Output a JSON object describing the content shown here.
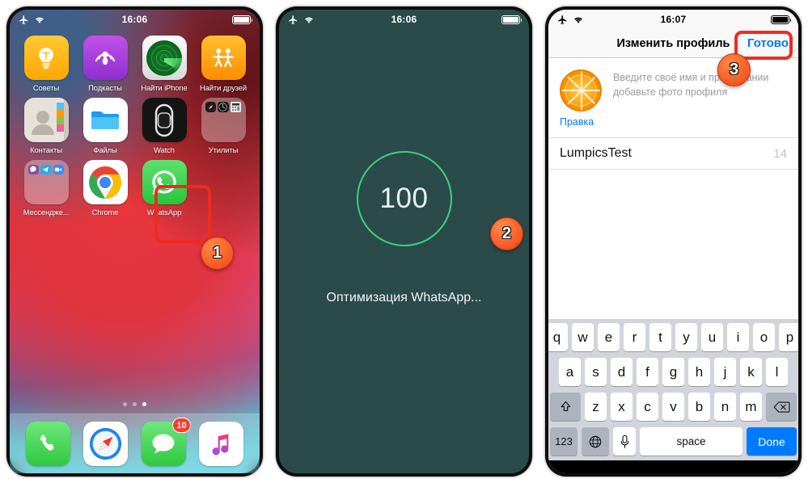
{
  "screens": [
    {
      "id": "home-screen",
      "status": {
        "airplane_icon": "airplane-mode-icon",
        "wifi_icon": "wifi-icon",
        "time": "16:06",
        "battery_icon": "battery-full-icon"
      },
      "apps_rows": [
        [
          {
            "label": "Советы",
            "icon": "tips-icon"
          },
          {
            "label": "Подкасты",
            "icon": "podcasts-icon"
          },
          {
            "label": "Найти iPhone",
            "icon": "find-my-iphone-icon"
          },
          {
            "label": "Найти друзей",
            "icon": "find-my-friends-icon"
          }
        ],
        [
          {
            "label": "Контакты",
            "icon": "contacts-icon"
          },
          {
            "label": "Файлы",
            "icon": "files-icon"
          },
          {
            "label": "Watch",
            "icon": "watch-icon"
          },
          {
            "label": "Утилиты",
            "icon": "utilities-folder-icon"
          }
        ],
        [
          {
            "label": "Мессендже...",
            "icon": "messengers-folder-icon"
          },
          {
            "label": "Chrome",
            "icon": "chrome-icon"
          },
          {
            "label": "WhatsApp",
            "icon": "whatsapp-icon"
          }
        ]
      ],
      "page_dots": {
        "count": 3,
        "active_index": 2
      },
      "dock": [
        {
          "label": "Телефон",
          "icon": "phone-icon",
          "badge": ""
        },
        {
          "label": "Safari",
          "icon": "safari-icon",
          "badge": ""
        },
        {
          "label": "Сообщения",
          "icon": "messages-icon",
          "badge": "10"
        },
        {
          "label": "Музыка",
          "icon": "music-icon",
          "badge": ""
        }
      ],
      "step_badge": "1"
    },
    {
      "id": "optimizing-screen",
      "status": {
        "airplane_icon": "airplane-mode-icon",
        "wifi_icon": "wifi-icon",
        "time": "16:06",
        "battery_icon": "battery-full-icon"
      },
      "progress_value": "100",
      "progress_label": "Оптимизация WhatsApp...",
      "step_badge": "2",
      "background_color": "#2b4b4a",
      "ring_color": "#3fd17a"
    },
    {
      "id": "edit-profile-screen",
      "status": {
        "airplane_icon": "airplane-mode-icon",
        "wifi_icon": "wifi-icon",
        "time": "16:07",
        "battery_icon": "battery-full-icon"
      },
      "nav": {
        "title": "Изменить профиль",
        "done_label": "Готово",
        "done_color": "#007aff"
      },
      "profile": {
        "avatar_icon": "orange-slice-avatar",
        "hint": "Введите своё имя и при желании добавьте фото профиля",
        "edit_link": "Правка"
      },
      "name_field": {
        "value": "LumpicsTest",
        "counter": "14"
      },
      "step_badge": "3",
      "keyboard": {
        "row1": [
          "q",
          "w",
          "e",
          "r",
          "t",
          "y",
          "u",
          "i",
          "o",
          "p"
        ],
        "row2": [
          "a",
          "s",
          "d",
          "f",
          "g",
          "h",
          "j",
          "k",
          "l"
        ],
        "row3": [
          "z",
          "x",
          "c",
          "v",
          "b",
          "n",
          "m"
        ],
        "shift_icon": "shift-icon",
        "backspace_icon": "backspace-icon",
        "numbers_key": "123",
        "globe_icon": "globe-icon",
        "mic_icon": "microphone-icon",
        "space_label": "space",
        "done_label": "Done"
      }
    }
  ],
  "highlight_color": "#ef2b21"
}
